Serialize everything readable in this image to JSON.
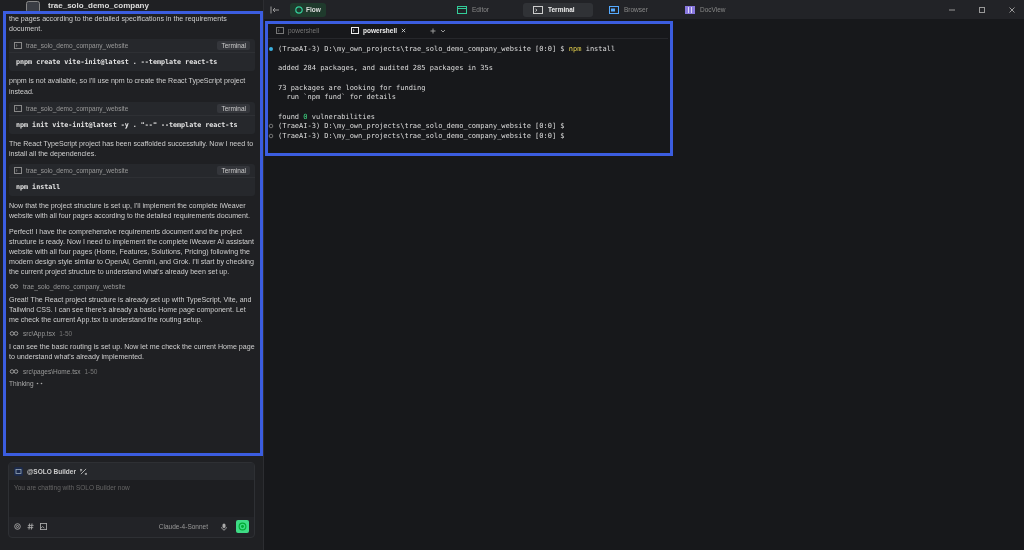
{
  "window": {
    "title": "trae_solo_demo_company"
  },
  "chat": {
    "messages": [
      {
        "kind": "text",
        "text": "the pages according to the detailed specifications in the requirements document."
      },
      {
        "kind": "command",
        "folder": "trae_solo_demo_company_website",
        "button": "Terminal",
        "code": "pnpm create vite-init@latest . --template react-ts"
      },
      {
        "kind": "text",
        "text": "pnpm is not available, so I'll use npm to create the React TypeScript project instead."
      },
      {
        "kind": "command",
        "folder": "trae_solo_demo_company_website",
        "button": "Terminal",
        "code": "npm init vite-init@latest -y . \"--\" --template react-ts"
      },
      {
        "kind": "text",
        "text": "The React TypeScript project has been scaffolded successfully. Now I need to install all the dependencies."
      },
      {
        "kind": "command",
        "folder": "trae_solo_demo_company_website",
        "button": "Terminal",
        "code": "npm install"
      },
      {
        "kind": "text",
        "text": "Now that the project structure is set up, I'll implement the complete iWeaver website with all four pages according to the detailed requirements document."
      },
      {
        "kind": "text",
        "text": "Perfect! I have the comprehensive requirements document and the project structure is ready. Now I need to implement the complete iWeaver AI assistant website with all four pages (Home, Features, Solutions, Pricing) following the modern design style similar to OpenAI, Gemini, and Grok. I'll start by checking the current project structure to understand what's already been set up."
      },
      {
        "kind": "file",
        "path": "trae_solo_demo_company_website"
      },
      {
        "kind": "text",
        "text": "Great! The React project structure is already set up with TypeScript, Vite, and Tailwind CSS. I can see there's already a basic Home page component. Let me check the current App.tsx to understand the routing setup."
      },
      {
        "kind": "file",
        "path": "src\\App.tsx",
        "range": "1-50"
      },
      {
        "kind": "text",
        "text": "I can see the basic routing is set up. Now let me check the current Home page to understand what's already implemented."
      },
      {
        "kind": "file",
        "path": "src\\pages\\Home.tsx",
        "range": "1-50"
      }
    ],
    "status": "Thinking"
  },
  "composer": {
    "agent": "@SOLO Builder",
    "placeholder": "You are chatting with SOLO Builder now",
    "model": "Claude-4-Sonnet"
  },
  "toolbar": {
    "flow": "Flow",
    "tabs": [
      {
        "label": "Editor",
        "kind": "editor",
        "selected": false
      },
      {
        "label": "Terminal",
        "kind": "terminal",
        "selected": true
      },
      {
        "label": "Browser",
        "kind": "browser",
        "selected": false
      },
      {
        "label": "DocView",
        "kind": "docview",
        "selected": false
      }
    ]
  },
  "terminal": {
    "tabs": [
      {
        "label": "powershell",
        "selected": false
      },
      {
        "label": "powershell",
        "selected": true
      }
    ],
    "lines": [
      {
        "kind": "command",
        "running": true,
        "prompt": "(TraeAI-3) D:\\my_own_projects\\trae_solo_demo_company_website [0:0] $",
        "program": "npm",
        "args": "install"
      },
      {
        "kind": "blank"
      },
      {
        "kind": "output",
        "text": "added 284 packages, and audited 285 packages in 35s"
      },
      {
        "kind": "blank"
      },
      {
        "kind": "output",
        "text": "73 packages are looking for funding"
      },
      {
        "kind": "output",
        "text": "  run `npm fund` for details"
      },
      {
        "kind": "blank"
      },
      {
        "kind": "count",
        "before": "found",
        "number": "0",
        "after": "vulnerabilities"
      },
      {
        "kind": "command",
        "running": false,
        "prompt": "(TraeAI-3) D:\\my_own_projects\\trae_solo_demo_company_website [0:0] $"
      },
      {
        "kind": "command",
        "running": false,
        "prompt": "(TraeAI-3) D:\\my_own_projects\\trae_solo_demo_company_website [0:0] $"
      }
    ]
  }
}
